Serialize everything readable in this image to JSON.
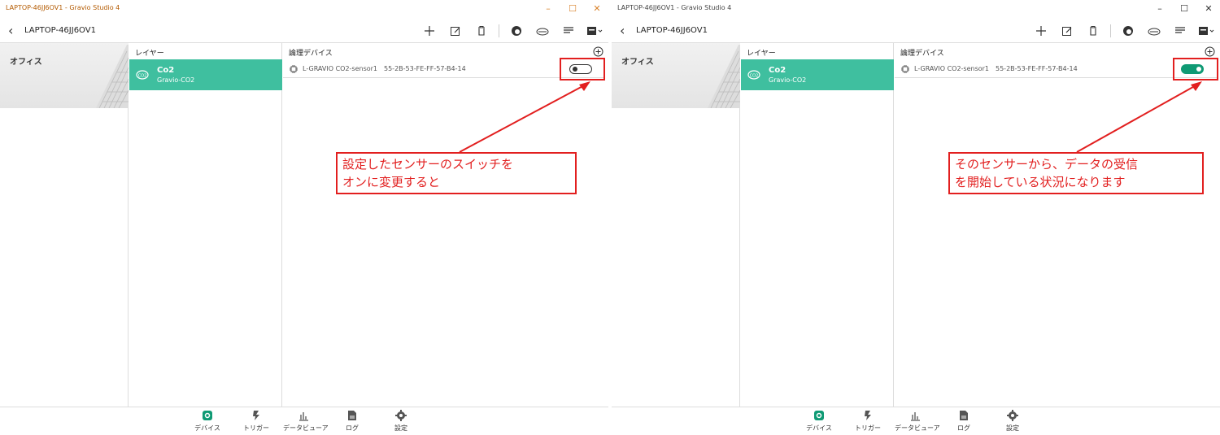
{
  "colors": {
    "accent": "#3fbf9f",
    "toggle_on": "#0f9a74",
    "annotation": "#e21f1f"
  },
  "panels": [
    {
      "window_title": "LAPTOP-46JJ6OV1 - Gravio Studio 4",
      "host_name": "LAPTOP-46JJ6OV1",
      "area_label": "オフィス",
      "layer_header": "レイヤー",
      "layer": {
        "name": "Co2",
        "sub": "Gravio-CO2"
      },
      "device_header": "論理デバイス",
      "device": {
        "name": "L-GRAVIO CO2-sensor1",
        "mac": "55-2B-53-FE-FF-57-B4-14",
        "toggle_state": "off"
      },
      "callout": {
        "line1": "設定したセンサーのスイッチを",
        "line2": "オンに変更すると"
      }
    },
    {
      "window_title": "LAPTOP-46JJ6OV1 - Gravio Studio 4",
      "host_name": "LAPTOP-46JJ6OV1",
      "area_label": "オフィス",
      "layer_header": "レイヤー",
      "layer": {
        "name": "Co2",
        "sub": "Gravio-CO2"
      },
      "device_header": "論理デバイス",
      "device": {
        "name": "L-GRAVIO CO2-sensor1",
        "mac": "55-2B-53-FE-FF-57-B4-14",
        "toggle_state": "on"
      },
      "callout": {
        "line1": "そのセンサーから、データの受信",
        "line2": "を開始している状況になります"
      }
    }
  ],
  "bottom_nav": [
    "デバイス",
    "トリガー",
    "データビューア",
    "ログ",
    "設定"
  ]
}
